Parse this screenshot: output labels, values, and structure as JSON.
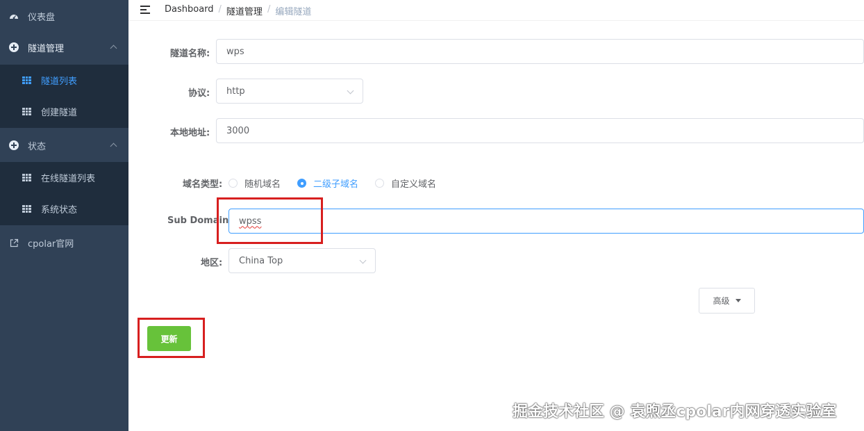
{
  "sidebar": {
    "dashboard": "仪表盘",
    "tunnel_mgmt": "隧道管理",
    "tunnel_list": "隧道列表",
    "create_tunnel": "创建隧道",
    "status": "状态",
    "online_tunnels": "在线隧道列表",
    "system_status": "系统状态",
    "cpolar_site": "cpolar官网"
  },
  "breadcrumb": {
    "home": "Dashboard",
    "separator": "/",
    "section": "隧道管理",
    "current": "编辑隧道"
  },
  "form": {
    "tunnel_name_label": "隧道名称:",
    "tunnel_name_value": "wps",
    "protocol_label": "协议:",
    "protocol_value": "http",
    "local_addr_label": "本地地址:",
    "local_addr_value": "3000",
    "domain_type_label": "域名类型:",
    "domain_options": [
      "随机域名",
      "二级子域名",
      "自定义域名"
    ],
    "domain_selected": "二级子域名",
    "subdomain_label": "Sub Domain:",
    "subdomain_value": "wpss",
    "region_label": "地区:",
    "region_value": "China Top",
    "advanced_button": "高级",
    "update_button": "更新"
  },
  "watermark": "掘金技术社区 @ 袁煦丞cpolar内网穿透实验室",
  "colors": {
    "sidebar_bg": "#304156",
    "submenu_bg": "#1f2d3d",
    "accent": "#409eff",
    "update_button": "#67c23a",
    "highlight_box": "#d71f1f"
  }
}
